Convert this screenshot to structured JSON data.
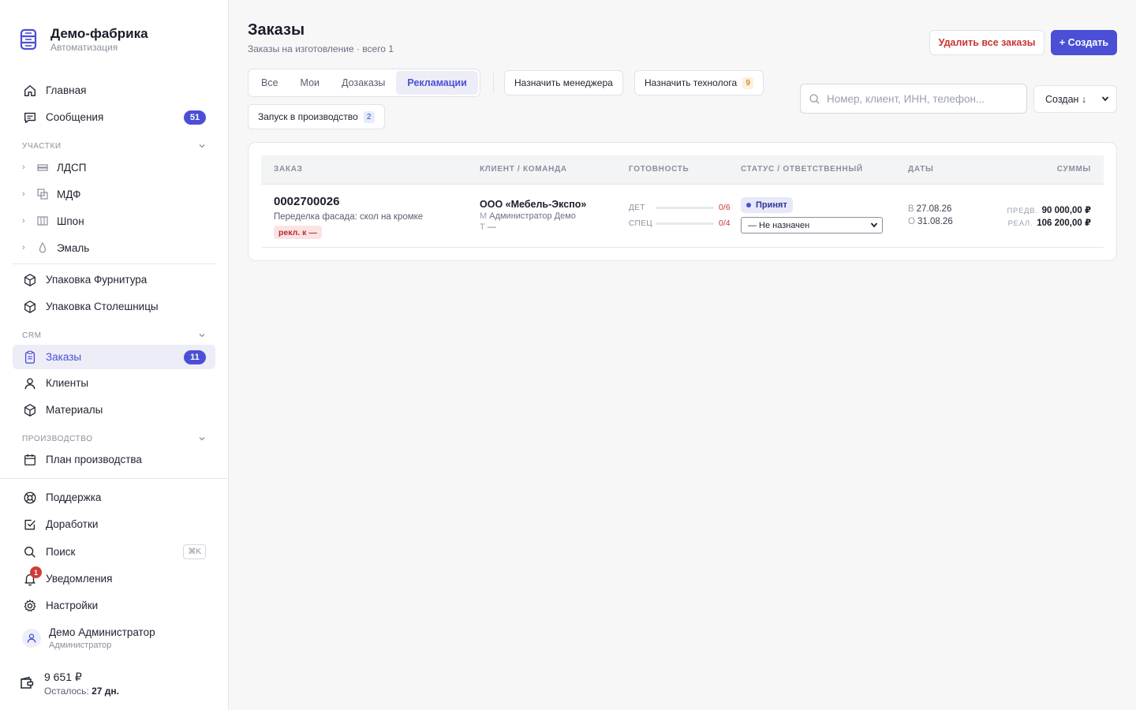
{
  "brand": {
    "title": "Демо-фабрика",
    "subtitle": "Автоматизация"
  },
  "nav": {
    "home": "Главная",
    "messages": {
      "label": "Сообщения",
      "count": "51"
    },
    "section_sites": "Участки",
    "sites": [
      "ЛДСП",
      "МДФ",
      "Шпон",
      "Эмаль"
    ],
    "packing": [
      "Упаковка Фурнитура",
      "Упаковка Столешницы"
    ],
    "section_crm": "CRM",
    "orders": {
      "label": "Заказы",
      "count": "11"
    },
    "clients": "Клиенты",
    "materials": "Материалы",
    "section_production": "Производство",
    "plan": "План производства",
    "support": "Поддержка",
    "improvements": "Доработки",
    "search": {
      "label": "Поиск",
      "shortcut": "⌘K"
    },
    "notifications": {
      "label": "Уведомления",
      "count": "1"
    },
    "settings": "Настройки"
  },
  "user": {
    "name": "Демо Администратор",
    "role": "Администратор"
  },
  "wallet": {
    "amount": "9 651 ₽",
    "left_label": "Осталось:",
    "left_value": "27 дн."
  },
  "header": {
    "title": "Заказы",
    "subtitle": "Заказы на изготовление · всего 1",
    "delete_all": "Удалить все заказы",
    "create": "+ Создать"
  },
  "tabs": [
    {
      "label": "Все",
      "active": false
    },
    {
      "label": "Мои",
      "active": false
    },
    {
      "label": "Дозаказы",
      "active": false
    },
    {
      "label": "Рекламации",
      "active": true
    }
  ],
  "chips": {
    "assign_manager": "Назначить менеджера",
    "assign_tech": {
      "label": "Назначить технолога",
      "count": "9"
    },
    "launch": {
      "label": "Запуск в производство",
      "count": "2"
    }
  },
  "search": {
    "placeholder": "Номер, клиент, ИНН, телефон...",
    "value": ""
  },
  "sort": {
    "selected": "Создан ↓"
  },
  "table": {
    "columns": [
      "ЗАКАЗ",
      "КЛИЕНТ / КОМАНДА",
      "ГОТОВНОСТЬ",
      "СТАТУС / ОТВЕТСТВЕННЫЙ",
      "ДАТЫ",
      "СУММЫ"
    ],
    "rows": [
      {
        "number": "0002700026",
        "description": "Переделка фасада: скол на кромке",
        "tag": "рекл. к —",
        "client": "ООО «Мебель-Экспо»",
        "manager_key": "М",
        "manager": "Администратор Демо",
        "tech_key": "Т",
        "tech": "—",
        "ready_det_label": "ДЕТ",
        "ready_det": "0/6",
        "ready_spec_label": "СПЕЦ",
        "ready_spec": "0/4",
        "status": "Принят",
        "responsible": "— Не назначен",
        "date_b_key": "В",
        "date_b": "27.08.26",
        "date_o_key": "О",
        "date_o": "31.08.26",
        "sum_pred_key": "ПРЕДВ.",
        "sum_pred": "90 000,00 ₽",
        "sum_real_key": "РЕАЛ.",
        "sum_real": "106 200,00 ₽"
      }
    ]
  },
  "colors": {
    "accent": "#4b4fd6",
    "danger": "#c73535",
    "sidebar_active_bg": "#ecedf7"
  }
}
